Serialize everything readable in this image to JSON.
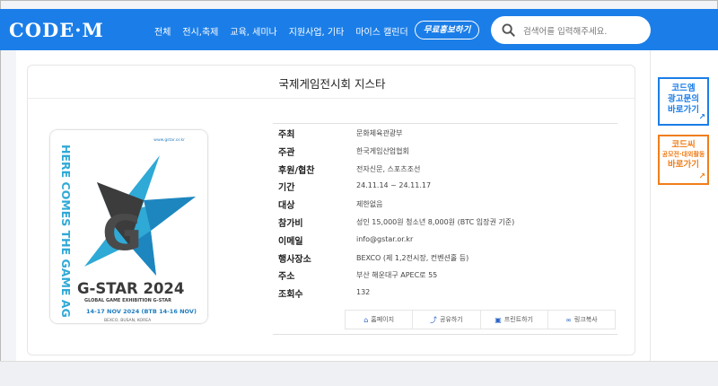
{
  "header": {
    "logo": "CODE·M",
    "nav": [
      "전체",
      "전시,축제",
      "교육, 세미나",
      "지원사업, 기타",
      "마이스 캘린더"
    ],
    "free_button": "무료홍보하기",
    "search_placeholder": "검색어를 입력해주세요.",
    "brand_color": "#1b7ee8"
  },
  "event": {
    "title": "국제게임전시회 지스타",
    "rows": [
      {
        "label": "주최",
        "value": "문화체육관광부"
      },
      {
        "label": "주관",
        "value": "한국게임산업협회"
      },
      {
        "label": "후원/협찬",
        "value": "전자신문, 스포츠조선"
      },
      {
        "label": "기간",
        "value": "24.11.14 ~ 24.11.17"
      },
      {
        "label": "대상",
        "value": "제한없음"
      },
      {
        "label": "참가비",
        "value": "성인 15,000원 청소년 8,000원 (BTC 입장권 기준)"
      },
      {
        "label": "이메일",
        "value": "info@gstar.or.kr"
      },
      {
        "label": "행사장소",
        "value": "BEXCO (제 1,2전시장, 컨벤션홀 등)"
      },
      {
        "label": "주소",
        "value": "부산 해운대구 APEC로 55"
      },
      {
        "label": "조회수",
        "value": "132"
      }
    ],
    "actions": [
      {
        "icon": "home-icon",
        "label": "홈페이지"
      },
      {
        "icon": "share-icon",
        "label": "공유하기"
      },
      {
        "icon": "print-icon",
        "label": "프린트하기"
      },
      {
        "icon": "link-icon",
        "label": "링크복사"
      }
    ]
  },
  "poster": {
    "url": "www.gstar.or.kr",
    "side_text": "HERE COMES THE GAME AG",
    "brand": "G-STAR 2024",
    "subtitle": "GLOBAL GAME EXHIBITION G-STAR",
    "dates": "14-17 NOV 2024 (BTB 14-16 NOV)",
    "venue": "BEXCO, BUSAN, KOREA"
  },
  "sidebar": {
    "banner1_line1": "코드엠",
    "banner1_line2": "광고문의",
    "banner1_line3": "바로가기",
    "banner2_line1": "코드씨",
    "banner2_line2": "공모전·대외활동",
    "banner2_line3": "바로가기"
  }
}
